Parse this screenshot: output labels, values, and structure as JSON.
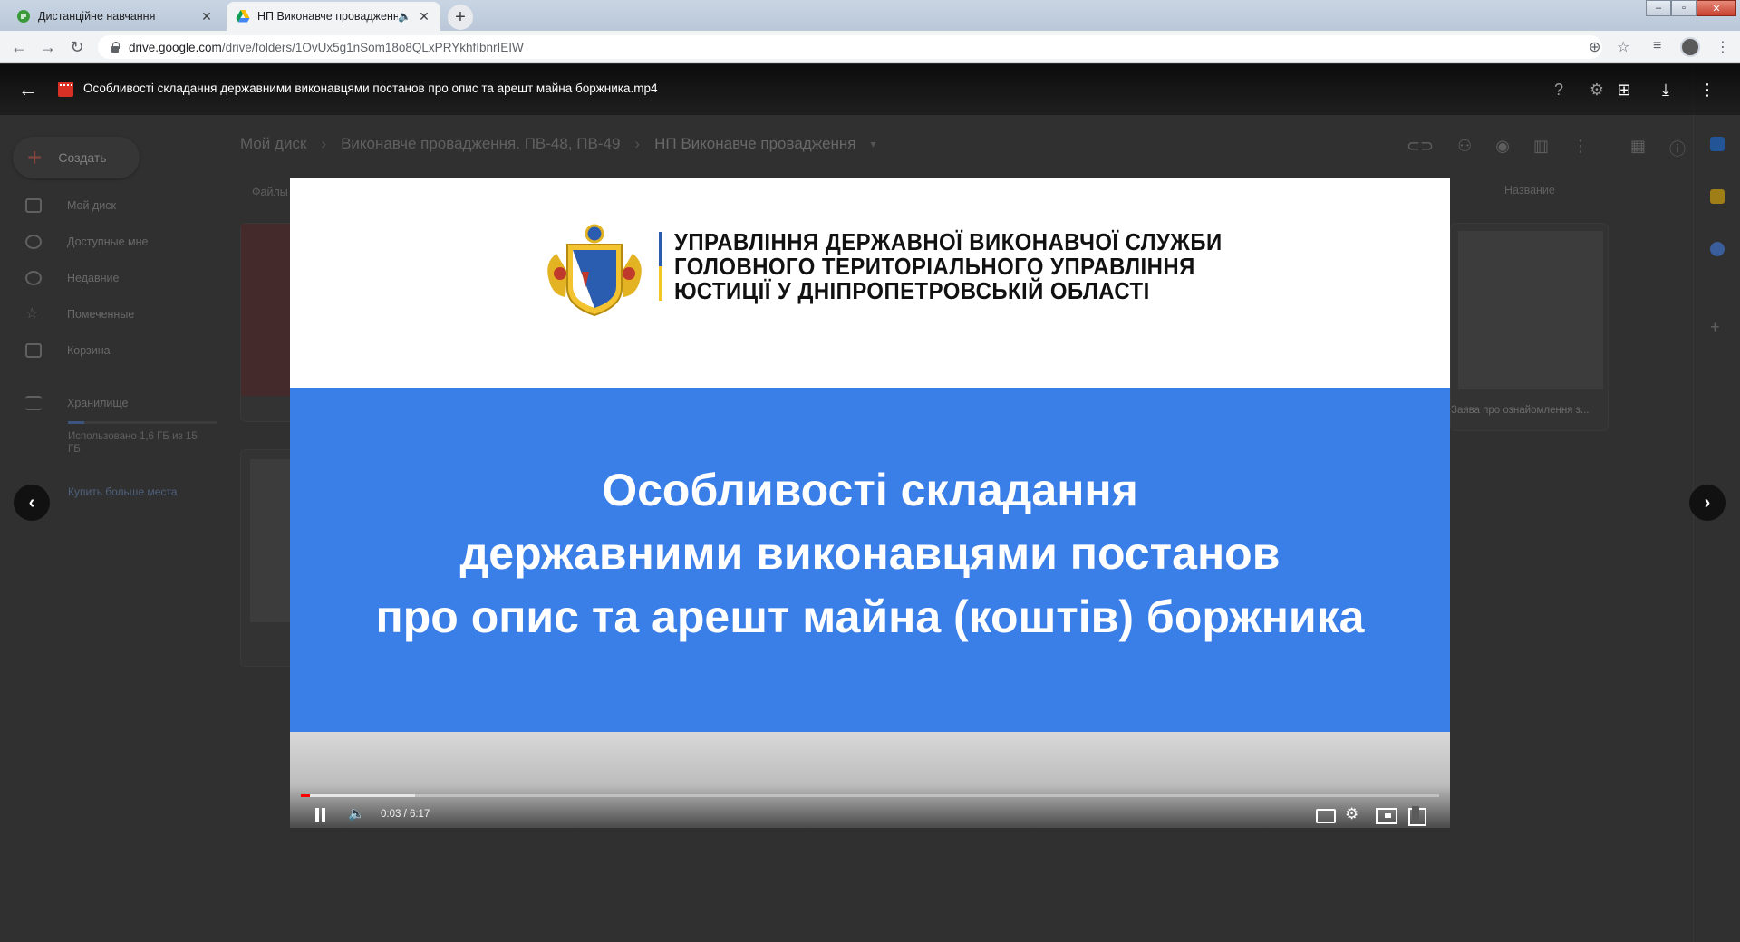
{
  "browser": {
    "tabs": [
      {
        "title": "Дистанційне навчання",
        "active": false
      },
      {
        "title": "НП Виконавче провадження",
        "active": true
      }
    ],
    "url_host": "drive.google.com",
    "url_path": "/drive/folders/1OvUx5g1nSom18o8QLxPRYkhfIbnrIEIW"
  },
  "drive": {
    "create_label": "Создать",
    "sidebar": [
      {
        "label": "Мой диск",
        "icon": "my-drive-icon"
      },
      {
        "label": "Доступные мне",
        "icon": "shared-icon"
      },
      {
        "label": "Недавние",
        "icon": "clock-icon"
      },
      {
        "label": "Помеченные",
        "icon": "star-icon"
      },
      {
        "label": "Корзина",
        "icon": "trash-icon"
      }
    ],
    "storage_label": "Хранилище",
    "storage_used": "Использовано 1,6 ГБ из 15 ГБ",
    "storage_fraction": 0.11,
    "buy_more": "Купить больше места",
    "breadcrumb": [
      "Мой диск",
      "Виконавче провадження. ПВ-48, ПВ-49",
      "НП Виконавче провадження"
    ],
    "files_label": "Файлы",
    "sort_label": "Название",
    "card_caption_right": "Заява про ознайомлення з..."
  },
  "viewer": {
    "file_title": "Особливості складання державними виконавцями постанов про опис та арешт майна боржника.mp4",
    "agency_lines": [
      "УПРАВЛІННЯ ДЕРЖАВНОЇ ВИКОНАВЧОЇ СЛУЖБИ",
      "ГОЛОВНОГО ТЕРИТОРІАЛЬНОГО УПРАВЛІННЯ",
      "ЮСТИЦІЇ У ДНІПРОПЕТРОВСЬКІЙ ОБЛАСТІ"
    ],
    "video_title_lines": [
      "Особливості складання",
      "державними виконавцями постанов",
      "про опис та арешт майна (коштів) боржника"
    ],
    "time_display": "0:03 / 6:17",
    "progress_fraction": 0.008,
    "buffered_fraction": 0.1,
    "colors": {
      "video_blue": "#3a7ee8",
      "progress_red": "#ff0000"
    }
  }
}
